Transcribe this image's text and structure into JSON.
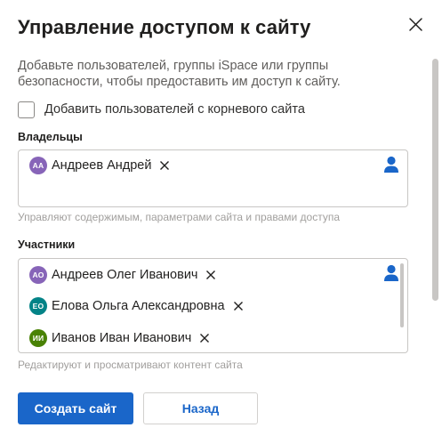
{
  "dialog": {
    "title": "Управление доступом к сайту",
    "close_icon": "close-icon",
    "description": "Добавьте пользователей, группы iSpace или группы безопасности, чтобы предоставить им доступ к сайту."
  },
  "root_checkbox": {
    "label": "Добавить пользователей с корневого сайта",
    "checked": false
  },
  "owners": {
    "label": "Владельцы",
    "people": [
      {
        "initials": "АА",
        "name": "Андреев Андрей",
        "color": "#8764b8"
      }
    ],
    "hint": "Управляют содержимым, параметрами сайта и правами доступа",
    "add_icon": "person-icon"
  },
  "members": {
    "label": "Участники",
    "people": [
      {
        "initials": "АО",
        "name": "Андреев Олег Иванович",
        "color": "#8764b8"
      },
      {
        "initials": "ЕО",
        "name": "Елова Ольга Александровна",
        "color": "#038387"
      },
      {
        "initials": "ИИ",
        "name": "Иванов Иван Иванович",
        "color": "#498205"
      }
    ],
    "hint": "Редактируют и просматривают контент сайта",
    "add_icon": "person-icon"
  },
  "buttons": {
    "create": "Создать сайт",
    "back": "Назад"
  },
  "colors": {
    "accent": "#1a66c9",
    "person_icon": "#1a66c9"
  }
}
